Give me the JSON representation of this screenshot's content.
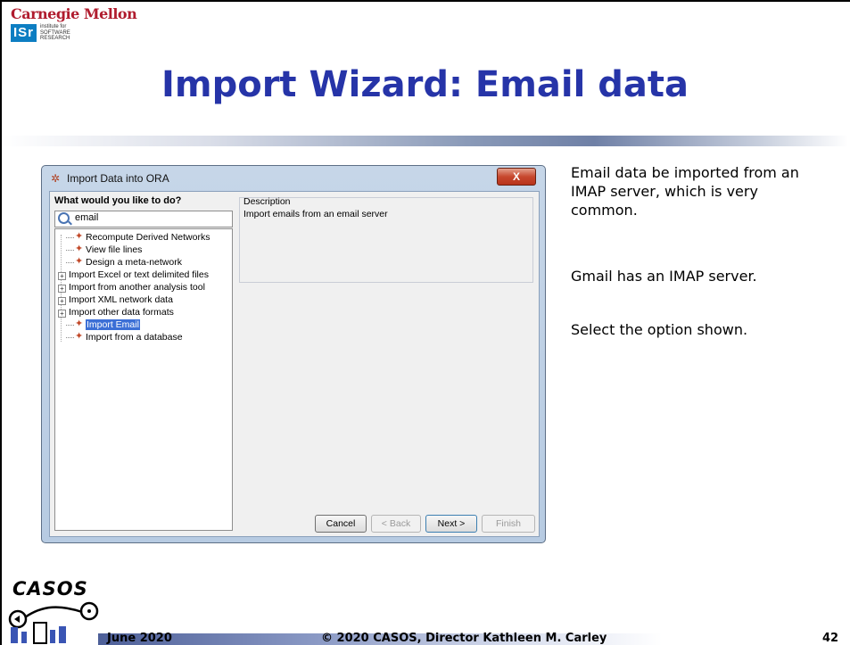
{
  "header": {
    "cmu_logo_text": "Carnegie Mellon",
    "isr_mark": "ISr",
    "isr_lines": [
      "institute for",
      "SOFTWARE",
      "RESEARCH"
    ]
  },
  "slide_title": "Import Wizard: Email data",
  "dialog": {
    "title": "Import Data into ORA",
    "close_label": "X",
    "prompt": "What would you like to do?",
    "search": {
      "value": "email"
    },
    "tree_items": [
      {
        "label": "Recompute Derived Networks",
        "kind": "leaf",
        "icon": "wand-icon"
      },
      {
        "label": "View file lines",
        "kind": "leaf",
        "icon": "wand-icon"
      },
      {
        "label": "Design a meta-network",
        "kind": "leaf",
        "icon": "wand-icon"
      },
      {
        "label": "Import Excel or text delimited files",
        "kind": "folder",
        "expander": "+"
      },
      {
        "label": "Import from another analysis tool",
        "kind": "folder",
        "expander": "+"
      },
      {
        "label": "Import XML network data",
        "kind": "folder",
        "expander": "+"
      },
      {
        "label": "Import other data formats",
        "kind": "folder",
        "expander": "+"
      },
      {
        "label": "Import Email",
        "kind": "leaf",
        "icon": "wand-icon",
        "selected": true
      },
      {
        "label": "Import from a database",
        "kind": "leaf",
        "icon": "wand-icon"
      }
    ],
    "description": {
      "title": "Description",
      "text": "Import emails from an email server"
    },
    "buttons": {
      "cancel": "Cancel",
      "back": "< Back",
      "next": "Next >",
      "finish": "Finish"
    }
  },
  "notes": {
    "p1": "Email data be imported from an IMAP server, which is very common.",
    "p2": "Gmail has an IMAP server.",
    "p3": "Select the option shown."
  },
  "footer": {
    "logo_text": "CASOS",
    "date": "June 2020",
    "copyright": "© 2020 CASOS, Director Kathleen M. Carley",
    "page_number": "42"
  },
  "colors": {
    "title_blue": "#2634a8",
    "cmu_red": "#b01c2e",
    "selection_blue": "#3b6fd6"
  }
}
